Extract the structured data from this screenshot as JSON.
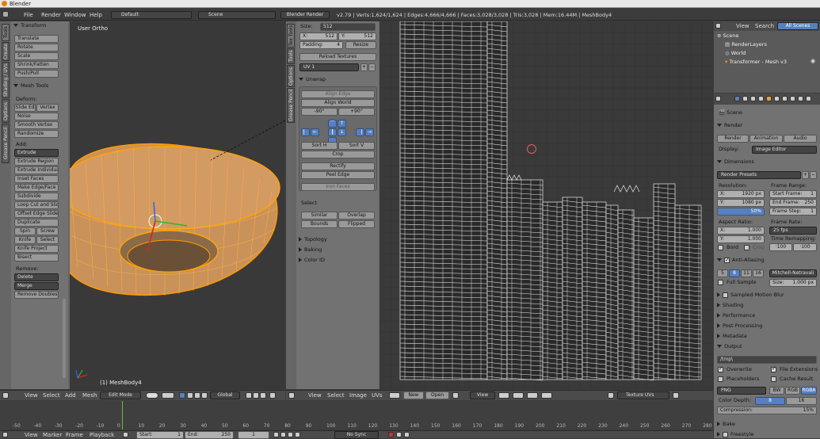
{
  "window": {
    "title": "Blender"
  },
  "topbar": {
    "menus": [
      "File",
      "Render",
      "Window",
      "Help"
    ],
    "layout": "Default",
    "scene": "Scene",
    "engine": "Blender Render",
    "stats": "v2.79 | Verts:1,624/1,624 | Edges:4,666/4,666 | Faces:3,028/3,028 | Tris:3,028 | Mem:16.44M | MeshBody4"
  },
  "toolshelf": {
    "tabs": [
      "Tools",
      "Create",
      "Shading / UVs",
      "Options",
      "Grease Pencil"
    ],
    "transform": {
      "title": "Transform",
      "items": [
        "Translate",
        "Rotate",
        "Scale",
        "Shrink/Fatten",
        "Push/Pull"
      ]
    },
    "meshtools": {
      "title": "Mesh Tools",
      "deform_label": "Deform:",
      "slide_edge": "Slide Ed",
      "vertex": "Vertex",
      "noise": "Noise",
      "smooth": "Smooth Vertex",
      "randomize": "Randomize",
      "add_label": "Add:",
      "extrude": "Extrude",
      "add_items": [
        "Extrude Region",
        "Extrude Individual",
        "Inset Faces",
        "Make Edge/Face",
        "Subdivide",
        "Loop Cut and Slide",
        "Offset Edge Slide",
        "Duplicate"
      ],
      "spin": "Spin",
      "screw": "Screw",
      "knife": "Knife",
      "select": "Select",
      "knife_project": "Knife Project",
      "bisect": "Bisect",
      "remove_label": "Remove:",
      "delete": "Delete",
      "merge": "Merge",
      "remove_doubles": "Remove Doubles"
    }
  },
  "viewport": {
    "label": "User Ortho",
    "object": "(1) MeshBody4"
  },
  "viewport_header": {
    "menus": [
      "View",
      "Select",
      "Add",
      "Mesh"
    ],
    "mode": "Edit Mode",
    "orientation": "Global"
  },
  "uv_panel": {
    "tabs": [
      "Tex Tools",
      "Tools",
      "Options",
      "Grease Pencil"
    ],
    "size_label": "Size:",
    "size": "512",
    "x_label": "X:",
    "x": "512",
    "y_label": "Y:",
    "y": "512",
    "padding_label": "Padding:",
    "padding": "4",
    "resize": "Resize",
    "reload": "Reload Textures",
    "uvmap": "UV 1",
    "unwrap": "Unwrap",
    "align_edge": "Align Edge",
    "align_world": "Align World",
    "rot_neg": "-90°",
    "rot_pos": "+90°",
    "sort_h": "Sort H",
    "sort_v": "Sort V",
    "crop": "Crop",
    "rectify": "Rectify",
    "peel_edge": "Peel Edge",
    "iron_faces": "Iron Faces",
    "select_label": "Select",
    "similar": "Similar",
    "overlap": "Overlap",
    "bounds": "Bounds",
    "flipped": "Flipped",
    "sections": [
      "Topology",
      "Baking",
      "Color ID"
    ]
  },
  "uv_header": {
    "menus": [
      "View",
      "Select",
      "Image",
      "UVs"
    ],
    "new": "New",
    "open": "Open",
    "view": "View",
    "texture_uvs": "Texture UVs"
  },
  "outliner": {
    "view": "View",
    "search": "Search",
    "filter": "All Scenes",
    "items": [
      "Scene",
      "RenderLayers",
      "World",
      "Transformer - Mesh v3"
    ]
  },
  "properties": {
    "scene": "Scene",
    "render": {
      "title": "Render",
      "render_btn": "Render",
      "animation_btn": "Animation",
      "audio_btn": "Audio",
      "display_label": "Display:",
      "display": "Image Editor"
    },
    "dimensions": {
      "title": "Dimensions",
      "presets": "Render Presets",
      "resolution_label": "Resolution:",
      "res_x": "X:",
      "res_x_val": "1920 px",
      "res_y": "Y:",
      "res_y_val": "1080 px",
      "res_pct": "50%",
      "frame_range_label": "Frame Range:",
      "start": "Start Frame:",
      "start_val": "1",
      "end": "End Frame:",
      "end_val": "250",
      "step": "Frame Step:",
      "step_val": "1",
      "aspect_label": "Aspect Ratio:",
      "asp_x": "X:",
      "asp_x_val": "1.000",
      "asp_y": "Y:",
      "asp_y_val": "1.000",
      "frame_rate_label": "Frame Rate:",
      "fps": "25 fps",
      "remap_label": "Time Remapping:",
      "remap_old": "·100",
      "remap_new": "·100",
      "bord": "Bord",
      "crop": "Crop"
    },
    "aa": {
      "title": "Anti-Aliasing",
      "samples": [
        "5",
        "8",
        "11",
        "16"
      ],
      "filter": "Mitchell-Netravali",
      "full_sample": "Full Sample",
      "size_label": "Size:",
      "size": "1.000 px"
    },
    "collapsed": [
      "Sampled Motion Blur",
      "Shading",
      "Performance",
      "Post Processing",
      "Metadata"
    ],
    "output": {
      "title": "Output",
      "path": "/tmp\\",
      "overwrite": "Overwrite",
      "file_ext": "File Extensions",
      "placeholders": "Placeholders",
      "cache": "Cache Result",
      "format": "PNG",
      "bw": "BW",
      "rgb": "RGB",
      "rgba": "RGBA",
      "depth_label": "Color Depth:",
      "depth8": "8",
      "depth16": "16",
      "compression_label": "Compression:",
      "compression": "15%"
    },
    "bottom_sections": [
      "Bake",
      "Freestyle"
    ]
  },
  "timeline": {
    "ticks": [
      "-50",
      "-40",
      "-30",
      "-20",
      "-10",
      "0",
      "10",
      "20",
      "30",
      "40",
      "50",
      "60",
      "70",
      "80",
      "90",
      "100",
      "110",
      "120",
      "130",
      "140",
      "150",
      "160",
      "170",
      "180",
      "190",
      "200",
      "210",
      "220",
      "230",
      "240",
      "250",
      "260",
      "270",
      "280"
    ],
    "menus": [
      "View",
      "Marker",
      "Frame",
      "Playback"
    ],
    "start_label": "Start:",
    "start": "1",
    "end_label": "End:",
    "end": "250",
    "current": "1",
    "sync": "No Sync"
  },
  "colors": {
    "accent": "#5680c2",
    "mesh": "#f0a020",
    "select_orange": "#ff9a00"
  }
}
